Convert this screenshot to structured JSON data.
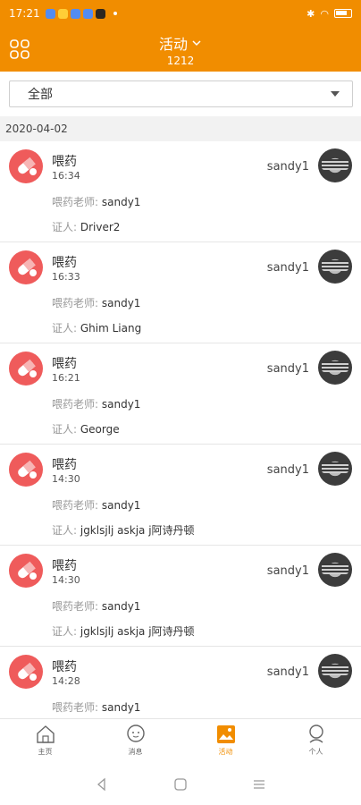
{
  "status_bar": {
    "time": "17:21"
  },
  "header": {
    "title": "活动",
    "subtitle": "1212"
  },
  "filter": {
    "selected": "全部"
  },
  "date_header": "2020-04-02",
  "labels": {
    "teacher": "喂药老师: ",
    "witness": "证人: "
  },
  "entries": [
    {
      "title": "喂药",
      "time": "16:34",
      "user": "sandy1",
      "teacher": "sandy1",
      "witness": "Driver2"
    },
    {
      "title": "喂药",
      "time": "16:33",
      "user": "sandy1",
      "teacher": "sandy1",
      "witness": "Ghim Liang"
    },
    {
      "title": "喂药",
      "time": "16:21",
      "user": "sandy1",
      "teacher": "sandy1",
      "witness": "George"
    },
    {
      "title": "喂药",
      "time": "14:30",
      "user": "sandy1",
      "teacher": "sandy1",
      "witness": "jgklsjlj  askja j阿诗丹顿"
    },
    {
      "title": "喂药",
      "time": "14:30",
      "user": "sandy1",
      "teacher": "sandy1",
      "witness": "jgklsjlj  askja j阿诗丹顿"
    },
    {
      "title": "喂药",
      "time": "14:28",
      "user": "sandy1",
      "teacher": "sandy1",
      "witness": ""
    }
  ],
  "tabs": [
    {
      "label": "主页",
      "icon": "home-icon"
    },
    {
      "label": "消息",
      "icon": "message-icon"
    },
    {
      "label": "活动",
      "icon": "activity-icon",
      "active": true
    },
    {
      "label": "个人",
      "icon": "profile-icon"
    }
  ],
  "colors": {
    "accent": "#f18d00",
    "pill": "#ef5b5b"
  }
}
